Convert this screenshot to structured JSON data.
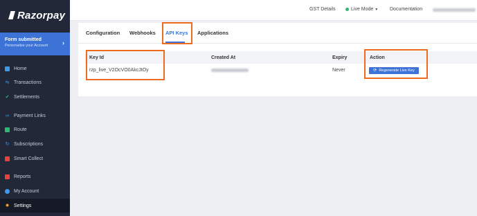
{
  "brand": {
    "name": "Razorpay"
  },
  "form_card": {
    "title": "Form submitted",
    "subtitle": "Personalize your Account"
  },
  "sidebar": {
    "items": [
      {
        "label": "Home",
        "icon": "home-icon",
        "color": "#3d9be9"
      },
      {
        "label": "Transactions",
        "icon": "transactions-icon",
        "color": "#3d9be9"
      },
      {
        "label": "Settlements",
        "icon": "check-icon",
        "color": "#2eb872"
      },
      {
        "label": "Payment Links",
        "icon": "link-icon",
        "color": "#3d9be9"
      },
      {
        "label": "Route",
        "icon": "route-icon",
        "color": "#2eb872"
      },
      {
        "label": "Subscriptions",
        "icon": "subscriptions-icon",
        "color": "#3d9be9"
      },
      {
        "label": "Smart Collect",
        "icon": "smart-collect-icon",
        "color": "#e5443d"
      },
      {
        "label": "Reports",
        "icon": "reports-icon",
        "color": "#e5443d"
      },
      {
        "label": "My Account",
        "icon": "account-icon",
        "color": "#3d9be9"
      },
      {
        "label": "Settings",
        "icon": "settings-icon",
        "color": "#f5a623"
      }
    ]
  },
  "topbar": {
    "gst_details": "GST Details",
    "live_mode": "Live Mode",
    "documentation": "Documentation"
  },
  "tabs": [
    {
      "label": "Configuration"
    },
    {
      "label": "Webhooks"
    },
    {
      "label": "API Keys",
      "active": true
    },
    {
      "label": "Applications"
    }
  ],
  "table": {
    "headers": {
      "key_id": "Key Id",
      "created_at": "Created At",
      "expiry": "Expiry",
      "action": "Action"
    },
    "rows": [
      {
        "key_id": "rzp_live_V2OcVO0AkcJtOy",
        "expiry": "Never",
        "action_label": "Regenerate Live Key"
      }
    ]
  },
  "colors": {
    "accent": "#3d73d6",
    "sidebar_bg": "#222838",
    "highlight": "#ee6a1d",
    "live_green": "#2eb872"
  }
}
